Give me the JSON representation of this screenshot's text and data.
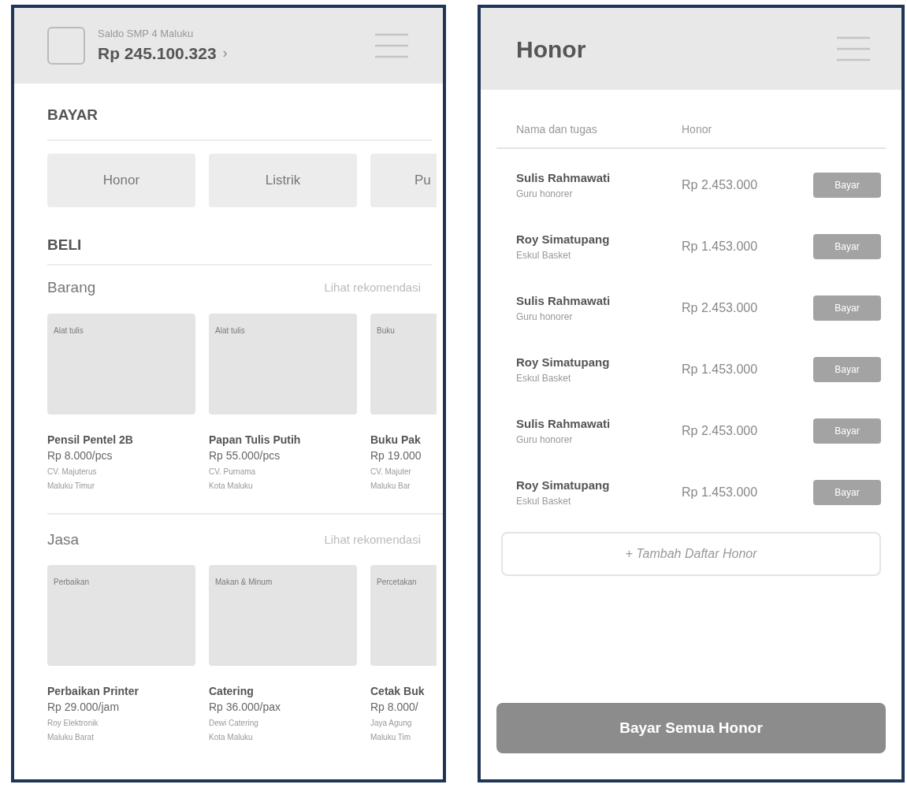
{
  "home": {
    "header": {
      "account_label": "Saldo SMP 4 Maluku",
      "balance": "Rp 245.100.323",
      "chevron": "›"
    },
    "bayar": {
      "title": "BAYAR",
      "items": [
        "Honor",
        "Listrik",
        "Pu"
      ]
    },
    "beli": {
      "title": "BELI",
      "sections": [
        {
          "title": "Barang",
          "link": "Lihat rekomendasi",
          "items": [
            {
              "tag": "Alat tulis",
              "name": "Pensil Pentel 2B",
              "price": "Rp 8.000/pcs",
              "seller": "CV. Majuterus",
              "location": "Maluku Timur"
            },
            {
              "tag": "Alat tulis",
              "name": "Papan Tulis Putih",
              "price": "Rp 55.000/pcs",
              "seller": "CV. Purnama",
              "location": "Kota Maluku"
            },
            {
              "tag": "Buku",
              "name": "Buku Pak",
              "price": "Rp 19.000",
              "seller": "CV. Majuter",
              "location": "Maluku Bar"
            }
          ]
        },
        {
          "title": "Jasa",
          "link": "Lihat rekomendasi",
          "items": [
            {
              "tag": "Perbaikan",
              "name": "Perbaikan Printer",
              "price": "Rp 29.000/jam",
              "seller": "Roy Elektronik",
              "location": "Maluku Barat"
            },
            {
              "tag": "Makan & Minum",
              "name": "Catering",
              "price": "Rp 36.000/pax",
              "seller": "Dewi Catering",
              "location": "Kota Maluku"
            },
            {
              "tag": "Percetakan",
              "name": "Cetak Buk",
              "price": "Rp 8.000/",
              "seller": "Jaya Agung",
              "location": "Maluku Tim"
            }
          ]
        }
      ]
    }
  },
  "honor": {
    "title": "Honor",
    "columns": [
      "Nama dan tugas",
      "Honor"
    ],
    "rows": [
      {
        "name": "Sulis Rahmawati",
        "task": "Guru honorer",
        "amount": "Rp 2.453.000",
        "button": "Bayar"
      },
      {
        "name": "Roy Simatupang",
        "task": "Eskul Basket",
        "amount": "Rp 1.453.000",
        "button": "Bayar"
      },
      {
        "name": "Sulis Rahmawati",
        "task": "Guru honorer",
        "amount": "Rp 2.453.000",
        "button": "Bayar"
      },
      {
        "name": "Roy Simatupang",
        "task": "Eskul Basket",
        "amount": "Rp 1.453.000",
        "button": "Bayar"
      },
      {
        "name": "Sulis Rahmawati",
        "task": "Guru honorer",
        "amount": "Rp 2.453.000",
        "button": "Bayar"
      },
      {
        "name": "Roy Simatupang",
        "task": "Eskul Basket",
        "amount": "Rp 1.453.000",
        "button": "Bayar"
      }
    ],
    "add_button": "+ Tambah Daftar Honor",
    "pay_all_button": "Bayar Semua Honor"
  }
}
